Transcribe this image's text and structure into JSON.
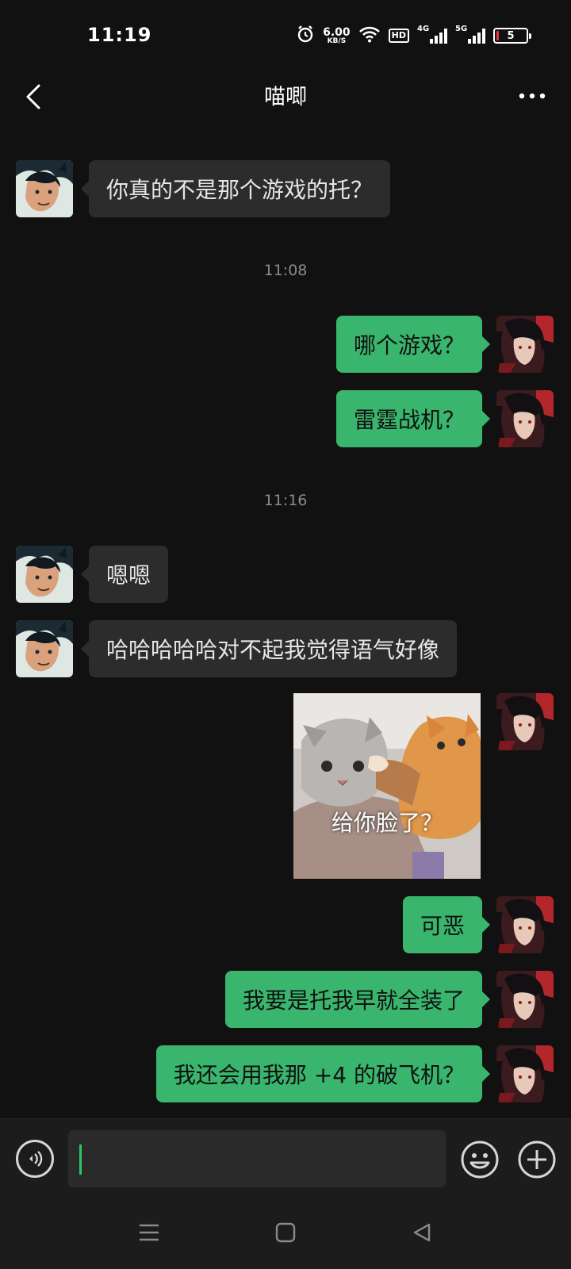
{
  "status_bar": {
    "time": "11:19",
    "net_speed_value": "6.00",
    "net_speed_unit": "KB/S",
    "hd_label": "HD",
    "sig1_label": "4G",
    "sig2_label": "5G",
    "battery_level": "5",
    "icons": [
      "alarm-icon",
      "wifi-icon",
      "signal-icon",
      "battery-icon"
    ]
  },
  "header": {
    "title": "喵唧",
    "back_icon": "chevron-left-icon",
    "more_icon": "more-dots-icon"
  },
  "messages": [
    {
      "side": "in",
      "text": "你真的不是那个游戏的托？"
    },
    {
      "type": "time",
      "text": "11:08"
    },
    {
      "side": "out",
      "text": "哪个游戏？"
    },
    {
      "side": "out",
      "text": "雷霆战机？"
    },
    {
      "type": "time",
      "text": "11:16"
    },
    {
      "side": "in",
      "text": "嗯嗯"
    },
    {
      "side": "in",
      "text": "哈哈哈哈哈对不起我觉得语气好像"
    },
    {
      "side": "out",
      "type": "sticker",
      "caption": "给你脸了？"
    },
    {
      "side": "out",
      "text": "可恶"
    },
    {
      "side": "out",
      "text": "我要是托我早就全装了"
    },
    {
      "side": "out",
      "text": "我还会用我那 +4 的破飞机？"
    }
  ],
  "colors": {
    "background": "#111111",
    "incoming_bubble": "#2c2c2c",
    "outgoing_bubble": "#39b56d",
    "timestamp": "#8a8a8a"
  },
  "input_bar": {
    "placeholder": "",
    "value": "",
    "icons": [
      "voice-icon",
      "emoji-icon",
      "plus-icon"
    ]
  },
  "system_nav": {
    "icons": [
      "menu-icon",
      "home-icon",
      "back-triangle-icon"
    ]
  }
}
